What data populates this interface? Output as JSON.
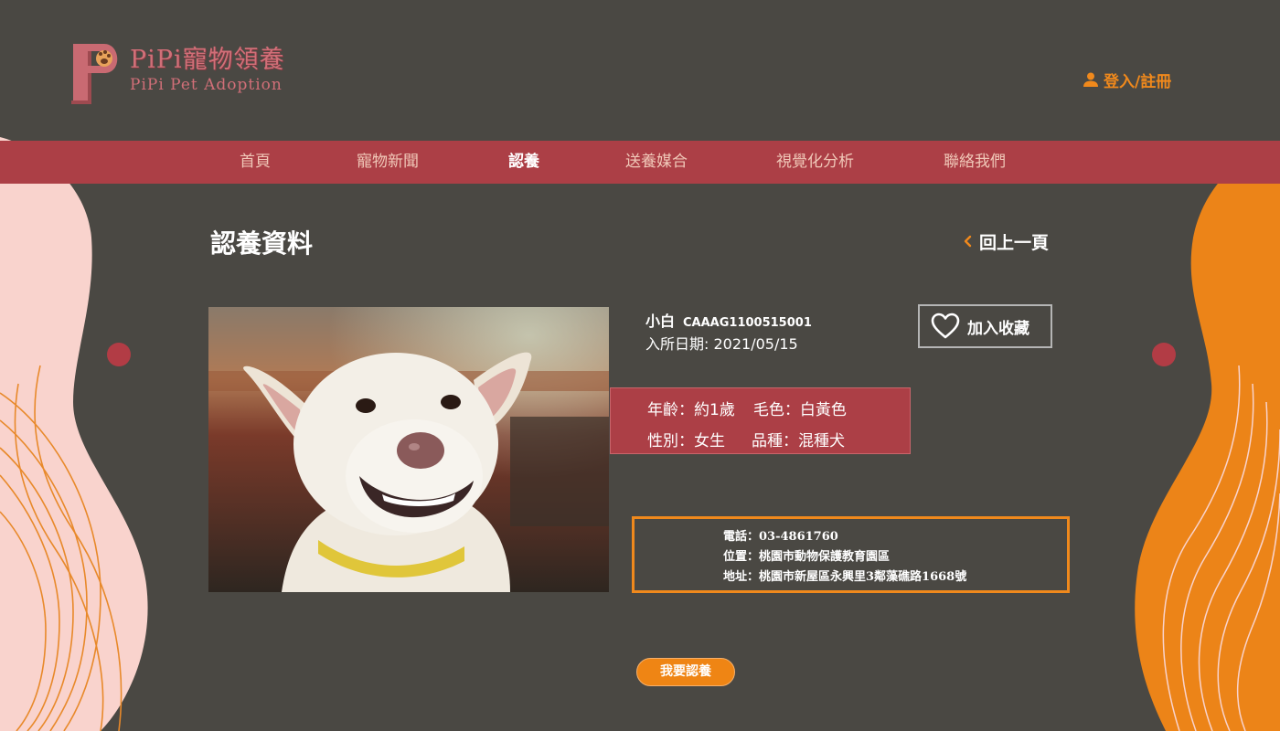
{
  "header": {
    "logo_letter": "P",
    "logo_title": "PiPi寵物領養",
    "logo_subtitle": "PiPi Pet Adoption",
    "login_label": "登入/註冊"
  },
  "nav": {
    "items": [
      {
        "label": "首頁",
        "active": false
      },
      {
        "label": "寵物新聞",
        "active": false
      },
      {
        "label": "認養",
        "active": true
      },
      {
        "label": "送養媒合",
        "active": false
      },
      {
        "label": "視覺化分析",
        "active": false
      },
      {
        "label": "聯絡我們",
        "active": false
      }
    ]
  },
  "page": {
    "title": "認養資料",
    "back_label": "回上一頁"
  },
  "pet": {
    "name": "小白",
    "code": "CAAAG1100515001",
    "intake_date": "入所日期:  2021/05/15",
    "favorite_label": "加入收藏",
    "age": "年齡：約1歲",
    "color": "毛色：白黃色",
    "gender": "性別：女生",
    "breed": "品種：混種犬"
  },
  "contact": {
    "phone": "電話：03-4861760",
    "location": "位置：桃園市動物保護教育園區",
    "address": "地址：桃園市新屋區永興里3鄰藻礁路1668號"
  },
  "actions": {
    "adopt_label": "我要認養"
  },
  "colors": {
    "background": "#4a4843",
    "brand_red": "#ac3f46",
    "accent_orange": "#f0891c",
    "pink": "#f9d3cd",
    "logo_pink": "#d16f78"
  }
}
